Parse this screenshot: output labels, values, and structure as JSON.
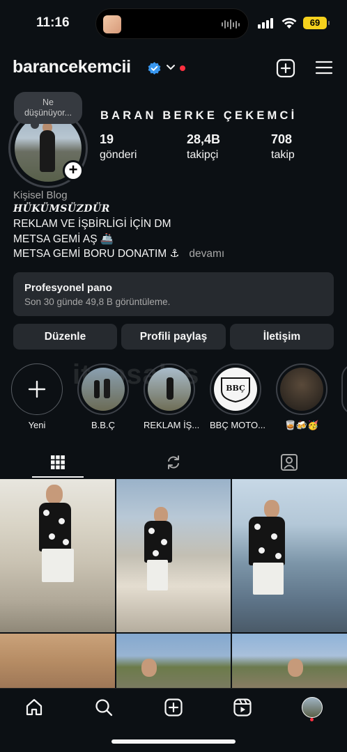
{
  "status_bar": {
    "time": "11:16",
    "battery": "69"
  },
  "header": {
    "username": "barancekemcii"
  },
  "note": {
    "line1": "Ne",
    "line2": "düşünüyor..."
  },
  "profile": {
    "display_name": "BARAN BERKE ÇEKEMCİ",
    "stats": [
      {
        "value": "19",
        "label": "gönderi"
      },
      {
        "value": "28,4B",
        "label": "takipçi"
      },
      {
        "value": "708",
        "label": "takip"
      }
    ],
    "category": "Kişisel Blog",
    "bio": [
      "HÜKÜMSÜZDÜR",
      "REKLAM VE İŞBİRLİGİ İÇİN DM",
      "METSA GEMİ AŞ 🚢",
      "METSA GEMİ BORU DONATIM ⚓"
    ],
    "more": "devamı"
  },
  "dashboard": {
    "title": "Profesyonel pano",
    "subtitle": "Son 30 günde 49,8 B görüntüleme."
  },
  "actions": {
    "edit": "Düzenle",
    "share": "Profili paylaş",
    "contact": "İletişim"
  },
  "highlights": [
    {
      "label": "Yeni"
    },
    {
      "label": "B.B.Ç"
    },
    {
      "label": "REKLAM İŞ..."
    },
    {
      "label": "BBÇ MOTO..."
    },
    {
      "label": "🥃🍻🥳"
    }
  ],
  "highlight_logo_text": "BBÇ",
  "watermark": "itopsales",
  "tabs": [
    "grid-icon",
    "reels-repost-icon",
    "tagged-icon"
  ],
  "nav": [
    "home-icon",
    "search-icon",
    "create-icon",
    "reels-icon",
    "profile-avatar"
  ]
}
